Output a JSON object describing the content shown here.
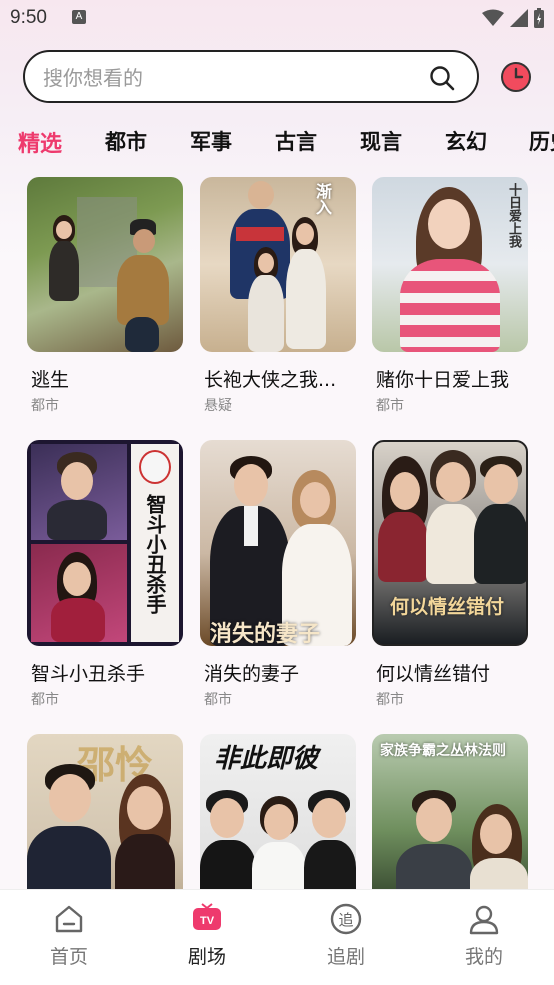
{
  "status": {
    "time": "9:50",
    "notif": "A"
  },
  "search": {
    "placeholder": "搜你想看的"
  },
  "tabs": [
    "精选",
    "都市",
    "军事",
    "古言",
    "现言",
    "玄幻",
    "历史"
  ],
  "cards": [
    {
      "title": "逃生",
      "tag": "都市"
    },
    {
      "title": "长袍大侠之我...",
      "tag": "悬疑"
    },
    {
      "title": "赌你十日爱上我",
      "tag": "都市",
      "art": "十日爱上我"
    },
    {
      "title": "智斗小丑杀手",
      "tag": "都市",
      "art": "智斗小丑杀手"
    },
    {
      "title": "消失的妻子",
      "tag": "都市",
      "art": "消失的妻子"
    },
    {
      "title": "何以情丝错付",
      "tag": "都市",
      "art": "何以情丝错付"
    },
    {
      "title": "",
      "tag": "",
      "art": "邵怜"
    },
    {
      "title": "",
      "tag": "",
      "art": "非此即彼"
    },
    {
      "title": "",
      "tag": "",
      "art": "家族争霸之丛林法则"
    }
  ],
  "nav": [
    {
      "label": "首页",
      "icon": "home-icon"
    },
    {
      "label": "剧场",
      "icon": "tv-icon"
    },
    {
      "label": "追剧",
      "icon": "follow-icon"
    },
    {
      "label": "我的",
      "icon": "profile-icon"
    }
  ],
  "colors": {
    "accent": "#ee3a6d",
    "history": "#f14b5e"
  }
}
